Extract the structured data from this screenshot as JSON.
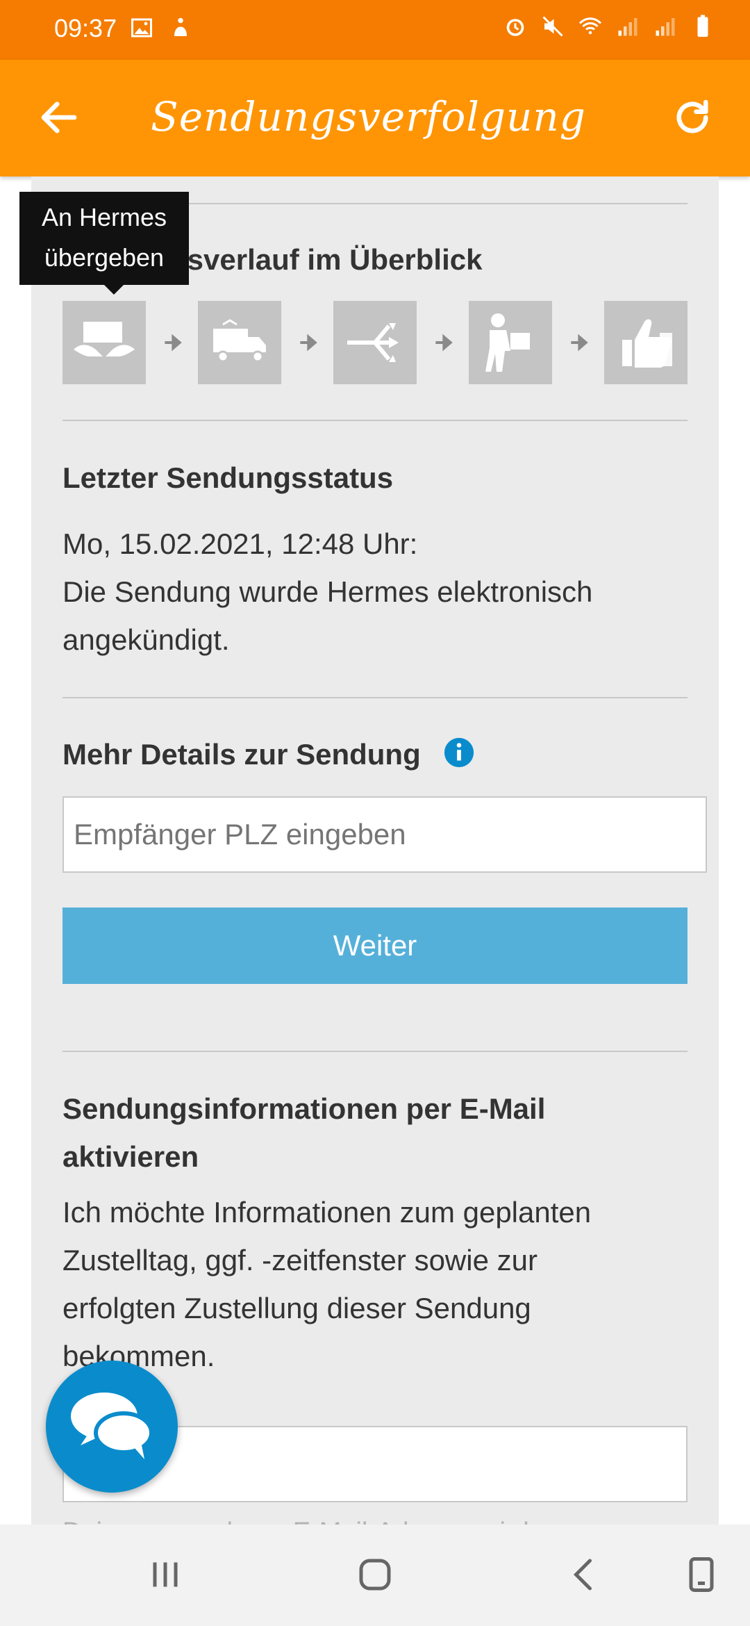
{
  "status_bar": {
    "time": "09:37"
  },
  "app_bar": {
    "title": "Sendungsverfolgung"
  },
  "tooltip": {
    "line1": "An Hermes",
    "line2": "übergeben"
  },
  "progress": {
    "heading": "Sendungsverlauf im Überblick",
    "steps": [
      {
        "icon": "handover-icon"
      },
      {
        "icon": "truck-icon"
      },
      {
        "icon": "distribution-icon"
      },
      {
        "icon": "courier-icon"
      },
      {
        "icon": "thumbs-up-icon"
      }
    ]
  },
  "last_status": {
    "heading": "Letzter Sendungsstatus",
    "datetime": "Mo, 15.02.2021, 12:48 Uhr:",
    "line1": "Die Sendung wurde Hermes elektronisch",
    "line2": "angekündigt."
  },
  "details": {
    "heading": "Mehr Details zur Sendung",
    "input_placeholder": "Empfänger PLZ eingeben",
    "button_label": "Weiter"
  },
  "email": {
    "heading_line1": "Sendungsinformationen per E-Mail",
    "heading_line2": "aktivieren",
    "body_line1": "Ich möchte Informationen zum geplanten",
    "body_line2": "Zustelltag, ggf. -zeitfenster sowie zur",
    "body_line3": "erfolgten Zustellung dieser Sendung",
    "body_line4": "bekommen.",
    "footer_partial": "Deine angegebene E-Mail-Adresse wird"
  },
  "colors": {
    "status_bar": "#f57c00",
    "app_bar": "#ff9505",
    "button": "#55b0d9",
    "fab": "#0a8ccc",
    "step_tile": "#c4c4c4"
  }
}
